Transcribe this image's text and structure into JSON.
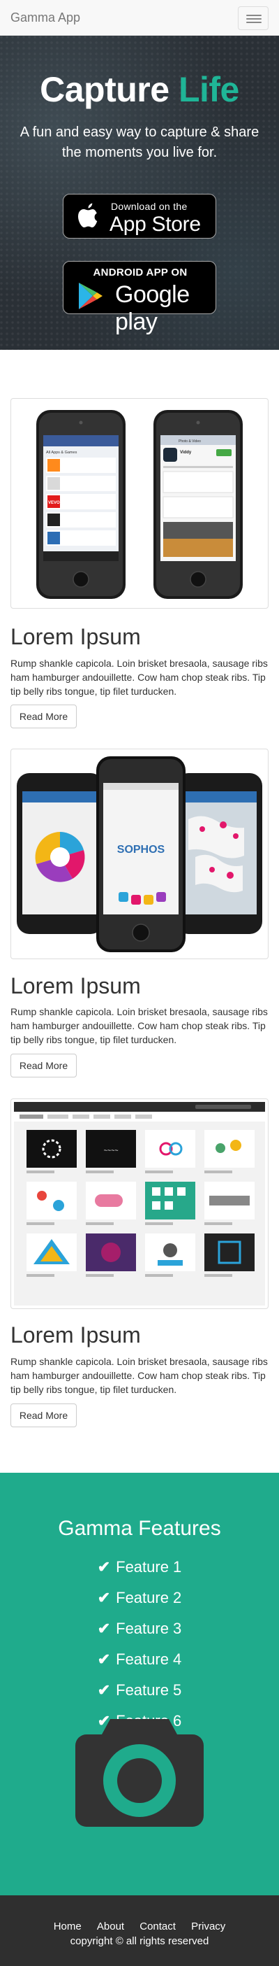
{
  "navbar": {
    "brand": "Gamma App"
  },
  "hero": {
    "title_white": "Capture ",
    "title_accent": "Life",
    "subtitle": "A fun and easy way to capture & share the moments you live for.",
    "apple_badge": {
      "line1": "Download on the",
      "line2": "App Store"
    },
    "google_badge": {
      "line1": "ANDROID APP ON",
      "line2": "Google play"
    }
  },
  "items": [
    {
      "heading": "Lorem Ipsum",
      "text": "Rump shankle capicola. Loin brisket bresaola, sausage ribs ham hamburger andouillette. Cow ham chop steak ribs. Tip tip belly ribs tongue, tip filet turducken.",
      "button": "Read More"
    },
    {
      "heading": "Lorem Ipsum",
      "text": "Rump shankle capicola. Loin brisket bresaola, sausage ribs ham hamburger andouillette. Cow ham chop steak ribs. Tip tip belly ribs tongue, tip filet turducken.",
      "button": "Read More"
    },
    {
      "heading": "Lorem Ipsum",
      "text": "Rump shankle capicola. Loin brisket bresaola, sausage ribs ham hamburger andouillette. Cow ham chop steak ribs. Tip tip belly ribs tongue, tip filet turducken.",
      "button": "Read More"
    }
  ],
  "screens": {
    "phone_a": {
      "tab": "All Apps & Games",
      "label": "VEVO"
    },
    "phone_b": {
      "title": "Viddy",
      "tab": "Photo & Video"
    },
    "phone_c": {
      "logo": "SOPHOS"
    }
  },
  "features": {
    "title": "Gamma Features",
    "list": [
      "Feature 1",
      "Feature 2",
      "Feature 3",
      "Feature 4",
      "Feature 5",
      "Feature 6"
    ]
  },
  "footer": {
    "links": [
      "Home",
      "About",
      "Contact",
      "Privacy"
    ],
    "copyright": "copyright © all rights reserved"
  },
  "colors": {
    "accent": "#1fb597",
    "features_bg": "#1fab8c",
    "footer_bg": "#2f2f2f",
    "hero_bg": "#2a3036"
  }
}
